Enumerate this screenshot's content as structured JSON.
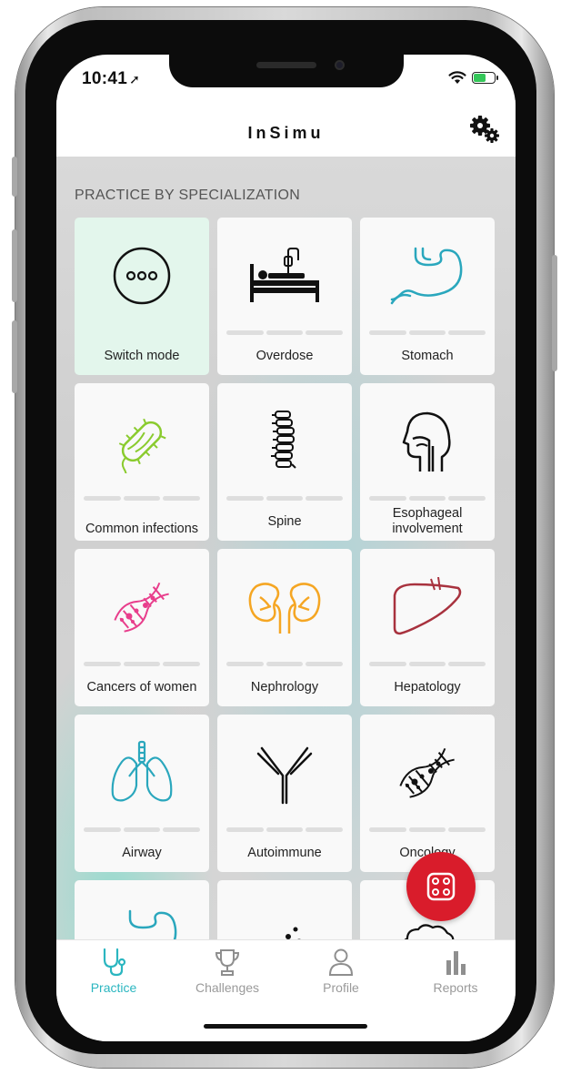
{
  "status_bar": {
    "time": "10:41",
    "location_arrow": "location-arrow-icon",
    "battery_color": "#34c759"
  },
  "header": {
    "title": "InSimu",
    "settings_icon": "gears-icon"
  },
  "section": {
    "title": "PRACTICE BY SPECIALIZATION"
  },
  "cards": [
    {
      "label": "Switch mode",
      "icon": "ellipsis-circle-icon",
      "active": true
    },
    {
      "label": "Overdose",
      "icon": "hospital-bed-icon"
    },
    {
      "label": "Stomach",
      "icon": "stomach-icon"
    },
    {
      "label": "Common infections",
      "icon": "bacteria-icon"
    },
    {
      "label": "Spine",
      "icon": "spine-icon"
    },
    {
      "label": "Esophageal involvement",
      "icon": "head-esophagus-icon"
    },
    {
      "label": "Cancers of women",
      "icon": "dna-pink-icon"
    },
    {
      "label": "Nephrology",
      "icon": "kidneys-icon"
    },
    {
      "label": "Hepatology",
      "icon": "liver-icon"
    },
    {
      "label": "Airway",
      "icon": "lungs-icon"
    },
    {
      "label": "Autoimmune",
      "icon": "antibody-icon"
    },
    {
      "label": "Oncology",
      "icon": "dna-black-icon"
    }
  ],
  "fab": {
    "icon": "dice-icon",
    "color": "#d91c2b"
  },
  "tabs": [
    {
      "label": "Practice",
      "icon": "stethoscope-icon",
      "active": true
    },
    {
      "label": "Challenges",
      "icon": "trophy-icon"
    },
    {
      "label": "Profile",
      "icon": "person-icon"
    },
    {
      "label": "Reports",
      "icon": "bar-chart-icon"
    }
  ],
  "colors": {
    "accent": "#2bb6c0",
    "active_card": "#e3f6ec"
  }
}
